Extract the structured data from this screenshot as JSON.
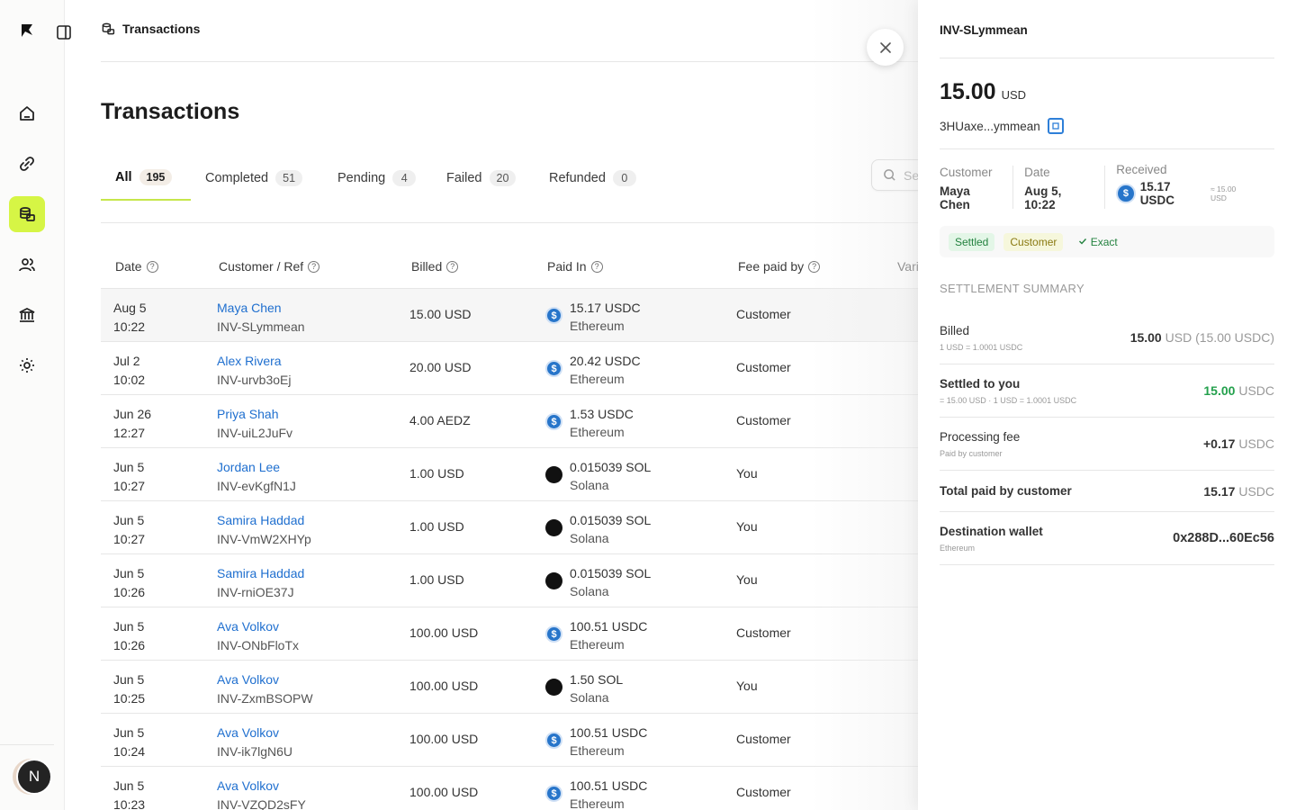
{
  "breadcrumb": {
    "label": "Transactions"
  },
  "page": {
    "title": "Transactions"
  },
  "tabs": [
    {
      "label": "All",
      "count": "195"
    },
    {
      "label": "Completed",
      "count": "51"
    },
    {
      "label": "Pending",
      "count": "4"
    },
    {
      "label": "Failed",
      "count": "20"
    },
    {
      "label": "Refunded",
      "count": "0"
    }
  ],
  "search": {
    "placeholder": "Se"
  },
  "table": {
    "headers": [
      "Date",
      "Customer / Ref",
      "Billed",
      "Paid In",
      "Fee paid by",
      "Vari"
    ],
    "rows": [
      {
        "date": "Aug 5",
        "time": "10:22",
        "name": "Maya Chen",
        "ref": "INV-SLymmean",
        "billed": "15.00 USD",
        "paid": "15.17 USDC",
        "network": "Ethereum",
        "coin": "usdc",
        "fee": "Customer"
      },
      {
        "date": "Jul 2",
        "time": "10:02",
        "name": "Alex Rivera",
        "ref": "INV-urvb3oEj",
        "billed": "20.00 USD",
        "paid": "20.42 USDC",
        "network": "Ethereum",
        "coin": "usdc",
        "fee": "Customer"
      },
      {
        "date": "Jun 26",
        "time": "12:27",
        "name": "Priya Shah",
        "ref": "INV-uiL2JuFv",
        "billed": "4.00 AEDZ",
        "paid": "1.53 USDC",
        "network": "Ethereum",
        "coin": "usdc",
        "fee": "Customer"
      },
      {
        "date": "Jun 5",
        "time": "10:27",
        "name": "Jordan Lee",
        "ref": "INV-evKgfN1J",
        "billed": "1.00 USD",
        "paid": "0.015039 SOL",
        "network": "Solana",
        "coin": "sol",
        "fee": "You"
      },
      {
        "date": "Jun 5",
        "time": "10:27",
        "name": "Samira Haddad",
        "ref": "INV-VmW2XHYp",
        "billed": "1.00 USD",
        "paid": "0.015039 SOL",
        "network": "Solana",
        "coin": "sol",
        "fee": "You"
      },
      {
        "date": "Jun 5",
        "time": "10:26",
        "name": "Samira Haddad",
        "ref": "INV-rniOE37J",
        "billed": "1.00 USD",
        "paid": "0.015039 SOL",
        "network": "Solana",
        "coin": "sol",
        "fee": "You"
      },
      {
        "date": "Jun 5",
        "time": "10:26",
        "name": "Ava Volkov",
        "ref": "INV-ONbFloTx",
        "billed": "100.00 USD",
        "paid": "100.51 USDC",
        "network": "Ethereum",
        "coin": "usdc",
        "fee": "Customer"
      },
      {
        "date": "Jun 5",
        "time": "10:25",
        "name": "Ava Volkov",
        "ref": "INV-ZxmBSOPW",
        "billed": "100.00 USD",
        "paid": "1.50 SOL",
        "network": "Solana",
        "coin": "sol",
        "fee": "You"
      },
      {
        "date": "Jun 5",
        "time": "10:24",
        "name": "Ava Volkov",
        "ref": "INV-ik7lgN6U",
        "billed": "100.00 USD",
        "paid": "100.51 USDC",
        "network": "Ethereum",
        "coin": "usdc",
        "fee": "Customer"
      },
      {
        "date": "Jun 5",
        "time": "10:23",
        "name": "Ava Volkov",
        "ref": "INV-VZQD2sFY",
        "billed": "100.00 USD",
        "paid": "100.51 USDC",
        "network": "Ethereum",
        "coin": "usdc",
        "fee": "Customer"
      }
    ]
  },
  "user": {
    "initial": "N"
  },
  "drawer": {
    "title": "INV-SLymmean",
    "amount": "15.00",
    "amount_unit": "USD",
    "tx_hash": "3HUaxe...ymmean",
    "customer_label": "Customer",
    "customer": "Maya Chen",
    "date_label": "Date",
    "date": "Aug 5, 10:22",
    "received_label": "Received",
    "received": "15.17 USDC",
    "received_eq": "≈ 15.00 USD",
    "badge_settled": "Settled",
    "badge_customer": "Customer",
    "badge_exact": "Exact",
    "section_title": "SETTLEMENT SUMMARY",
    "billed_label": "Billed",
    "billed_rate": "1 USD = 1.0001 USDC",
    "billed_value": "15.00",
    "billed_unit": "USD (15.00 USDC)",
    "settled_label": "Settled to you",
    "settled_sub": "= 15.00 USD · 1 USD = 1.0001 USDC",
    "settled_value": "15.00",
    "settled_unit": "USDC",
    "fee_label": "Processing fee",
    "fee_sub": "Paid by customer",
    "fee_value": "+0.17",
    "fee_unit": "USDC",
    "total_label": "Total paid by customer",
    "total_value": "15.17",
    "total_unit": "USDC",
    "wallet_label": "Destination wallet",
    "wallet_network": "Ethereum",
    "wallet_address": "0x288D...60Ec56"
  },
  "colors": {
    "accent": "#d6f545",
    "link": "#1f6fcf",
    "settled_green": "#23a04c",
    "usdc_blue": "#2775ca"
  }
}
